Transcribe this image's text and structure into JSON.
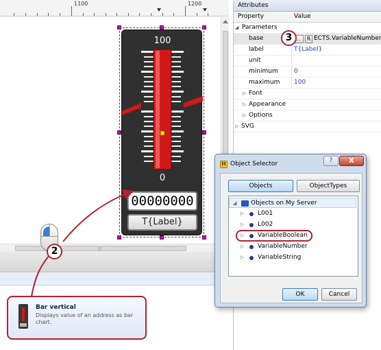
{
  "ruler": {
    "label_left": "1100",
    "label_right": "1200"
  },
  "gauge": {
    "max_label": "100",
    "min_label": "0",
    "value_display": "00000000",
    "label_display": "T{Label}"
  },
  "callouts": {
    "step2": "2",
    "step3": "3"
  },
  "tooltip": {
    "title": "Bar vertical",
    "description": "Displays value of an address as bar chart."
  },
  "attributes": {
    "title": "Attributes",
    "col_property": "Property",
    "col_value": "Value",
    "group_parameters": "Parameters",
    "rows": [
      {
        "key": "base",
        "value": "ECTS.VariableNumber"
      },
      {
        "key": "label",
        "value": "T{Label}"
      },
      {
        "key": "unit",
        "value": ""
      },
      {
        "key": "minimum",
        "value": "0"
      },
      {
        "key": "maximum",
        "value": "100"
      }
    ],
    "ellipsis_button": "...",
    "reset_button": "R",
    "groups": [
      "Font",
      "Appearance",
      "Options"
    ],
    "svg_group": "SVG"
  },
  "dialog": {
    "title": "Object Selector",
    "help_button": "?",
    "close_button": "X",
    "tab_objects": "Objects",
    "tab_types": "ObjectTypes",
    "root": "Objects on My Server",
    "items": [
      "L001",
      "L002",
      "VariableBoolean",
      "VariableNumber",
      "VariableString"
    ],
    "ok": "OK",
    "cancel": "Cancel"
  },
  "colors": {
    "accent_red": "#b22030",
    "gauge_bar": "#d01818",
    "link_blue": "#1c3fcf"
  }
}
